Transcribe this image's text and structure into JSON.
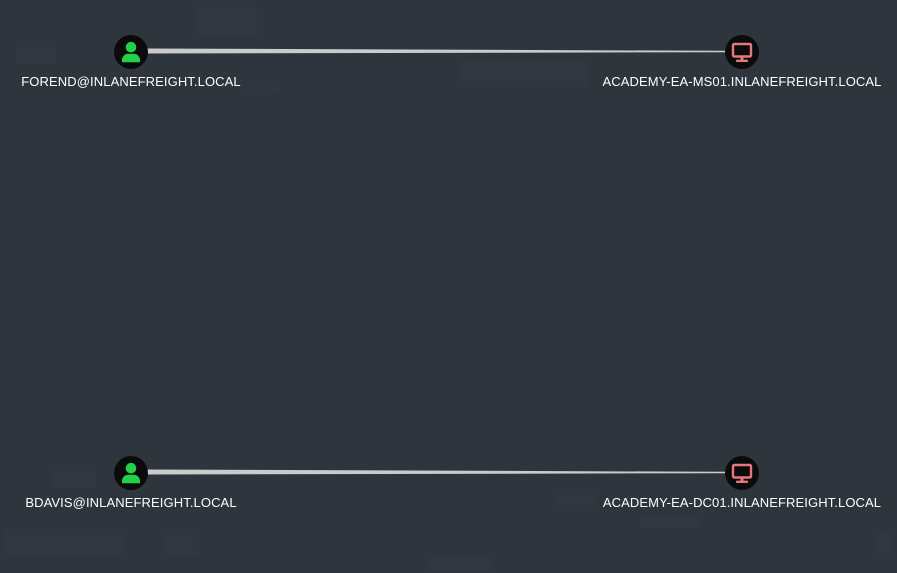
{
  "graph": {
    "nodes": [
      {
        "id": "forend",
        "type": "user",
        "label": "FOREND@INLANEFREIGHT.LOCAL",
        "icon": "user-icon",
        "color": "#22d147"
      },
      {
        "id": "ms01",
        "type": "computer",
        "label": "ACADEMY-EA-MS01.INLANEFREIGHT.LOCAL",
        "icon": "computer-icon",
        "color": "#e5787a"
      },
      {
        "id": "bdavis",
        "type": "user",
        "label": "BDAVIS@INLANEFREIGHT.LOCAL",
        "icon": "user-icon",
        "color": "#22d147"
      },
      {
        "id": "dc01",
        "type": "computer",
        "label": "ACADEMY-EA-DC01.INLANEFREIGHT.LOCAL",
        "icon": "computer-icon",
        "color": "#e5787a"
      }
    ],
    "edges": [
      {
        "from": "forend",
        "to": "ms01"
      },
      {
        "from": "bdavis",
        "to": "dc01"
      }
    ],
    "colors": {
      "background": "#2f353c",
      "edge": "#c9cbcd",
      "node_fill": "#0b0b0b",
      "label": "#ffffff"
    }
  }
}
